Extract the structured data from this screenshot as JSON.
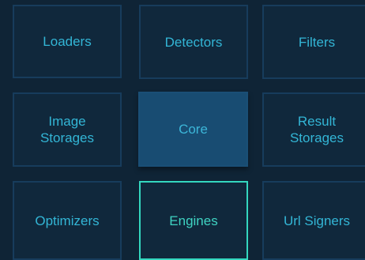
{
  "tiles": {
    "loaders": "Loaders",
    "detectors": "Detectors",
    "filters": "Filters",
    "image_storages": [
      "Image",
      "Storages"
    ],
    "core": "Core",
    "result_storages": [
      "Result",
      "Storages"
    ],
    "optimizers": "Optimizers",
    "engines": "Engines",
    "url_signers": "Url Signers"
  },
  "colors": {
    "background": "#0f2436",
    "tile_border": "#173c5c",
    "text": "#33b6d6",
    "core_fill": "#184c72",
    "engines_border": "#34d7bf"
  }
}
